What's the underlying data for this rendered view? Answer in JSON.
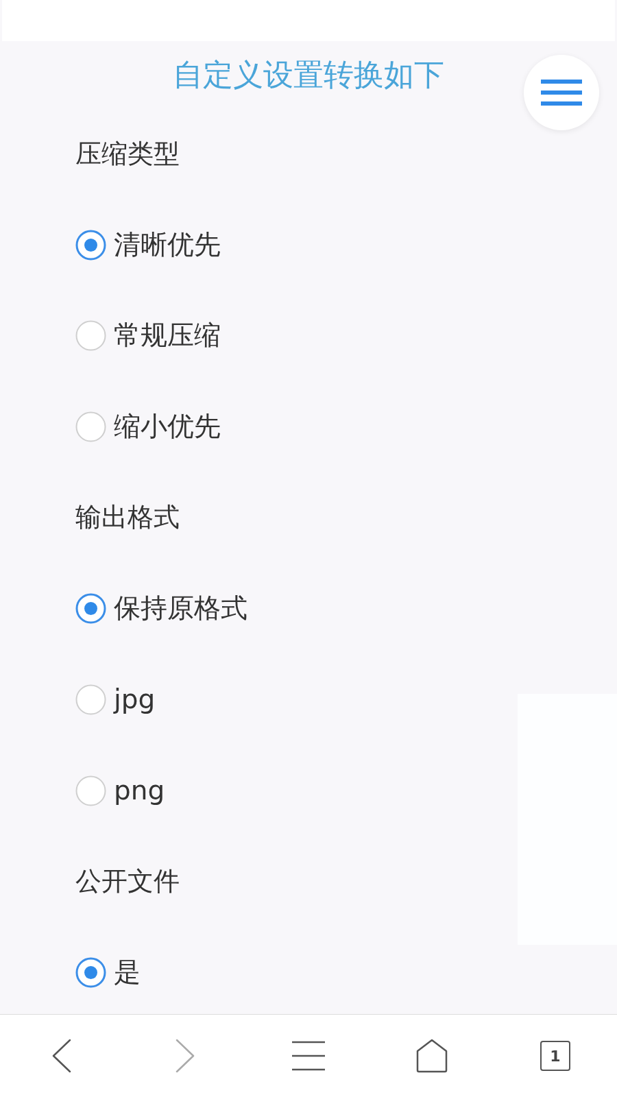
{
  "header": {
    "title": "自定义设置转换如下"
  },
  "sections": [
    {
      "label": "压缩类型",
      "options": [
        {
          "label": "清晰优先",
          "selected": true
        },
        {
          "label": "常规压缩",
          "selected": false
        },
        {
          "label": "缩小优先",
          "selected": false
        }
      ]
    },
    {
      "label": "输出格式",
      "options": [
        {
          "label": "保持原格式",
          "selected": true
        },
        {
          "label": "jpg",
          "selected": false
        },
        {
          "label": "png",
          "selected": false
        }
      ]
    },
    {
      "label": "公开文件",
      "options": [
        {
          "label": "是",
          "selected": true
        }
      ]
    }
  ],
  "bottom_nav": {
    "items": [
      {
        "kind": "back",
        "disabled": false
      },
      {
        "kind": "forward",
        "disabled": true
      },
      {
        "kind": "menu",
        "disabled": false
      },
      {
        "kind": "home",
        "disabled": false
      },
      {
        "kind": "tabs",
        "disabled": false,
        "count": "1"
      }
    ]
  }
}
